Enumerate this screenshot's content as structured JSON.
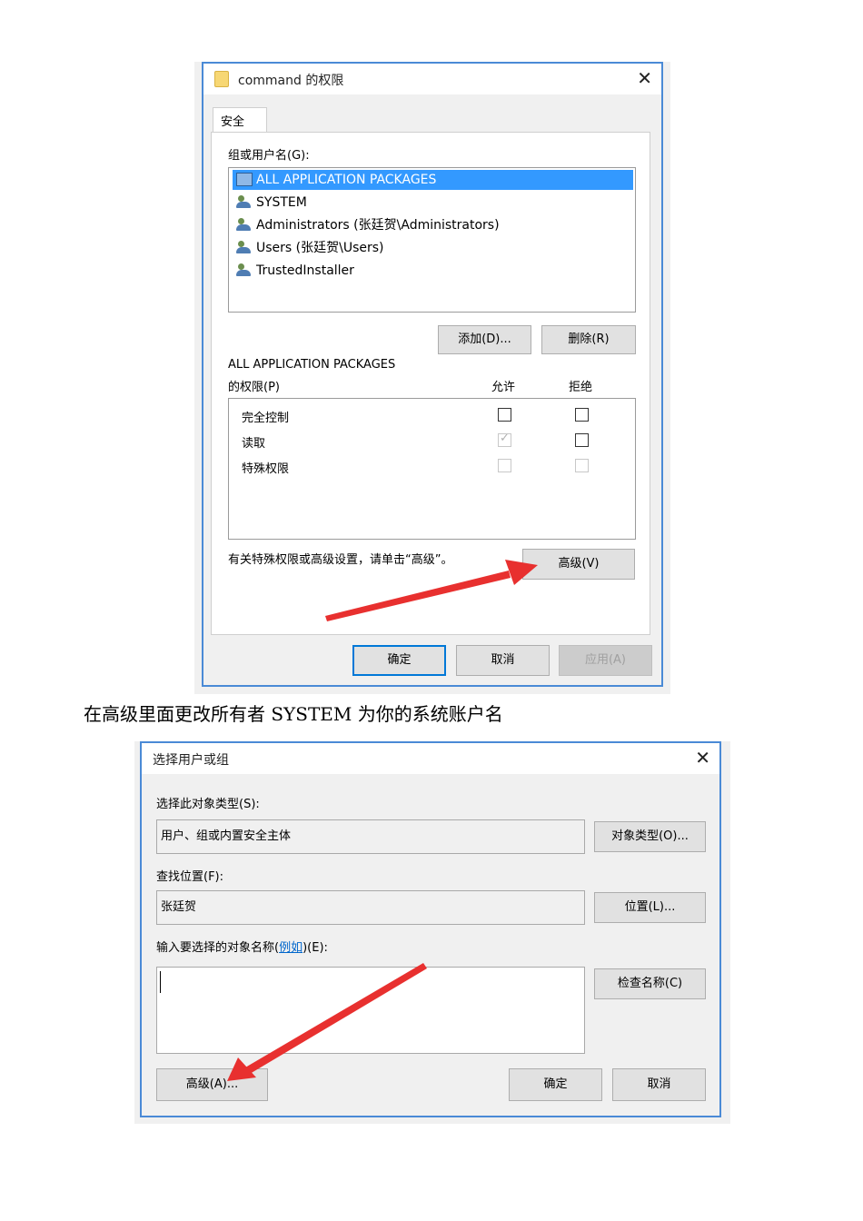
{
  "permissions_dialog": {
    "title": "command 的权限",
    "tab": "安全",
    "group_label": "组或用户名(G):",
    "principals": [
      {
        "name": "ALL APPLICATION PACKAGES",
        "icon": "package-icon",
        "selected": true
      },
      {
        "name": "SYSTEM",
        "icon": "user-group-icon",
        "selected": false
      },
      {
        "name": "Administrators (张廷贺\\Administrators)",
        "icon": "user-group-icon",
        "selected": false
      },
      {
        "name": "Users (张廷贺\\Users)",
        "icon": "user-group-icon",
        "selected": false
      },
      {
        "name": "TrustedInstaller",
        "icon": "user-group-icon",
        "selected": false
      }
    ],
    "add_button": "添加(D)...",
    "remove_button": "删除(R)",
    "perm_for_label": "ALL APPLICATION PACKAGES",
    "perm_label": "的权限(P)",
    "allow_header": "允许",
    "deny_header": "拒绝",
    "permissions": [
      {
        "name": "完全控制",
        "allow": false,
        "deny": false,
        "disabled": false
      },
      {
        "name": "读取",
        "allow": true,
        "deny": false,
        "disabled": true
      },
      {
        "name": "特殊权限",
        "allow": false,
        "deny": false,
        "disabled": true
      }
    ],
    "advanced_hint": "有关特殊权限或高级设置，请单击“高级”。",
    "advanced_button": "高级(V)",
    "ok_button": "确定",
    "cancel_button": "取消",
    "apply_button": "应用(A)"
  },
  "caption": "在高级里面更改所有者 SYSTEM 为你的系统账户名",
  "select_dialog": {
    "title": "选择用户或组",
    "object_type_label": "选择此对象类型(S):",
    "object_type_value": "用户、组或内置安全主体",
    "object_types_button": "对象类型(O)...",
    "location_label": "查找位置(F):",
    "location_value": "张廷贺",
    "locations_button": "位置(L)...",
    "enter_label_prefix": "输入要选择的对象名称(",
    "enter_label_link": "例如",
    "enter_label_suffix": ")(E):",
    "check_names_button": "检查名称(C)",
    "advanced_button": "高级(A)...",
    "ok_button": "确定",
    "cancel_button": "取消"
  },
  "colors": {
    "accent": "#0078d7",
    "selection": "#3399ff",
    "arrow": "#e8302f"
  }
}
